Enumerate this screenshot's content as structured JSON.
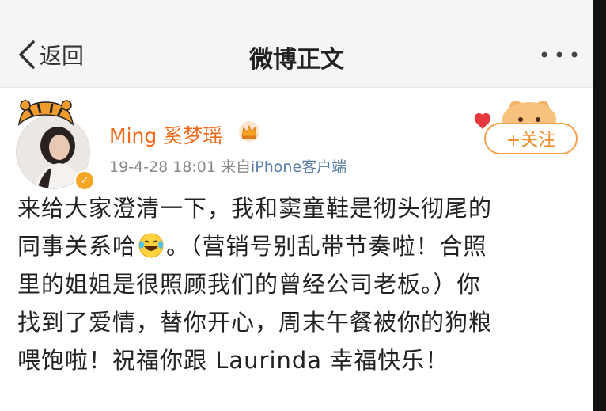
{
  "nav": {
    "back_label": "返回",
    "title": "微博正文"
  },
  "post": {
    "username": "Ming 奚梦瑶",
    "timestamp": "19-4-28 18:01",
    "source_prefix": "来自",
    "source": "iPhone客户端",
    "follow_label": "+关注",
    "lines": [
      "来给大家澄清一下，我和窦童鞋是彻头彻尾的",
      "同事关系哈",
      "。（营销号别乱带节奏啦！合照",
      "里的姐姐是很照顾我们的曾经公司老板。）你",
      "找到了爱情，替你开心，周末午餐被你的狗粮",
      "喂饱啦！祝福你跟 Laurinda 幸福快乐！"
    ]
  },
  "colors": {
    "username": "#f26b1d",
    "follow": "#f08a24",
    "source_link": "#5b7ea6",
    "verified": "#f5a623"
  },
  "icons": {
    "back": "chevron-left-icon",
    "more": "more-dots-icon",
    "crown": "crown-icon",
    "emoji": "laughing-tears-emoji-icon",
    "verified": "verified-badge-icon"
  }
}
